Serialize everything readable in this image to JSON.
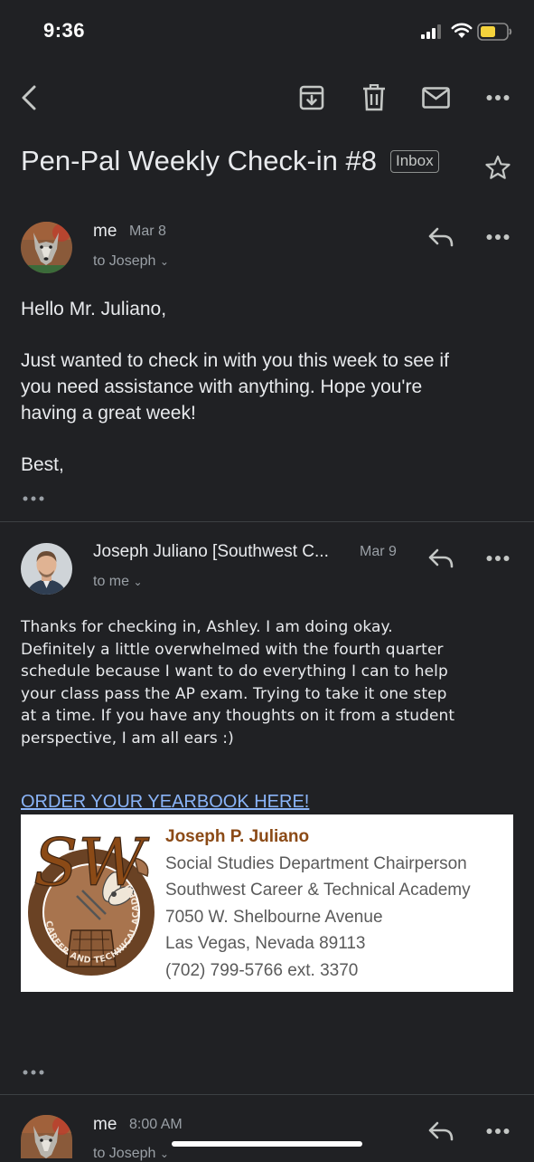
{
  "status_bar": {
    "time": "9:36"
  },
  "email": {
    "subject": "Pen-Pal Weekly Check-in #8",
    "label": "Inbox"
  },
  "messages": [
    {
      "sender": "me",
      "date": "Mar 8",
      "to": "to Joseph",
      "body": [
        "Hello Mr. Juliano,",
        "Just wanted to check in with you this week to see if",
        "you need assistance with anything. Hope you're",
        "having a great week!",
        "Best,"
      ]
    },
    {
      "sender": "Joseph Juliano [Southwest C...",
      "date": "Mar 9",
      "to": "to me",
      "body": [
        "Thanks for checking in, Ashley. I am doing okay.",
        "Definitely a little overwhelmed with the fourth quarter",
        "schedule because I want to do everything I can to help",
        "your class pass the AP exam. Trying to take it one step",
        "at a time. If you have any thoughts on it from a student",
        "perspective, I am all ears :)"
      ],
      "link_text": "ORDER YOUR YEARBOOK HERE!",
      "signature": {
        "name": "Joseph P. Juliano",
        "title": "Social Studies Department Chairperson",
        "org": "Southwest Career & Technical Academy",
        "address1": "7050 W. Shelbourne Avenue",
        "address2": "Las Vegas, Nevada 89113",
        "phone": "(702) 799-5766 ext. 3370",
        "logo_initials": "SW",
        "logo_ring_text": "CAREER AND TECHNICAL ACADEMY"
      }
    },
    {
      "sender": "me",
      "date": "8:00 AM",
      "to": "to Joseph"
    }
  ],
  "icons": {
    "back": "chevron-left-icon",
    "archive": "archive-icon",
    "delete": "trash-icon",
    "mark_unread": "mail-icon",
    "more": "more-horizontal-icon",
    "star": "star-icon",
    "reply": "reply-icon"
  }
}
